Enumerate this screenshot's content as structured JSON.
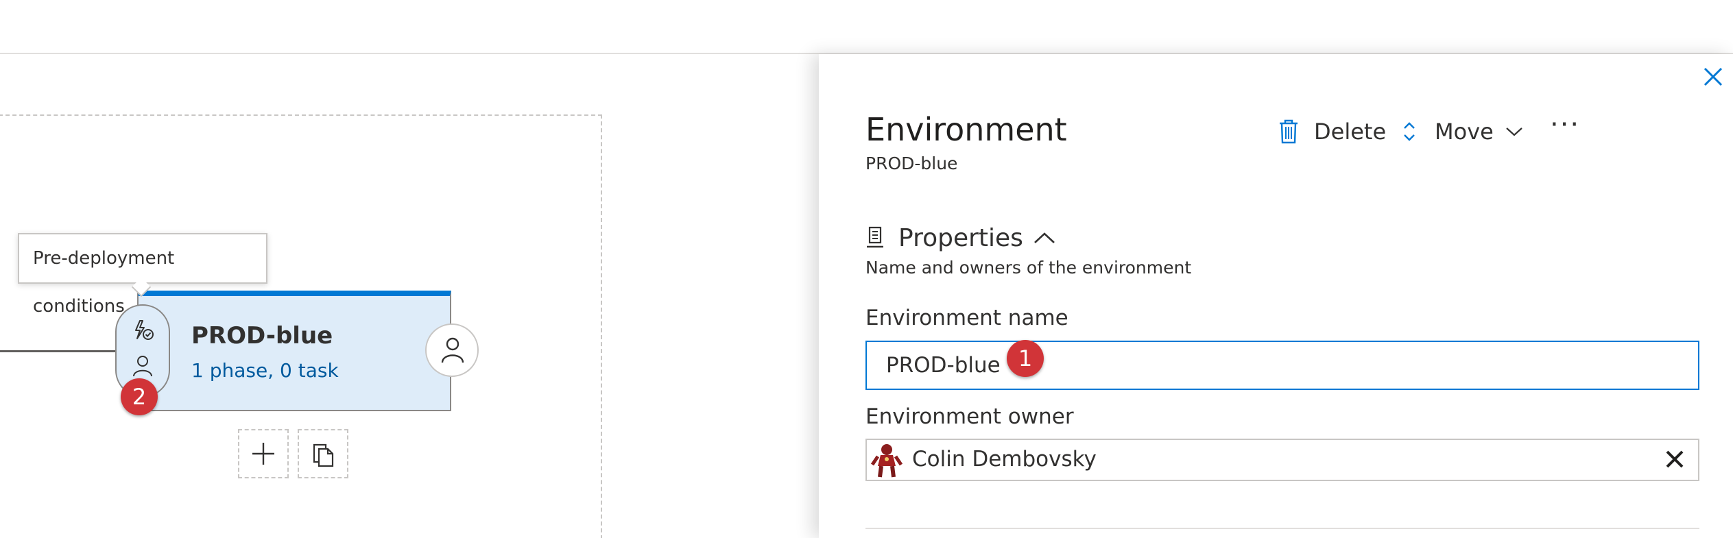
{
  "pipeline": {
    "tooltip": "Pre-deployment conditions",
    "environment": {
      "name": "PROD-blue",
      "summary": "1 phase, 0 task"
    },
    "badge_pre": "2"
  },
  "panel": {
    "title": "Environment",
    "subtitle": "PROD-blue",
    "toolbar": {
      "delete_label": "Delete",
      "move_label": "Move",
      "more_label": "···"
    },
    "properties": {
      "heading": "Properties",
      "description": "Name and owners of the environment"
    },
    "fields": {
      "name_label": "Environment name",
      "name_value": "PROD-blue",
      "name_badge": "1",
      "owner_label": "Environment owner",
      "owner_value": "Colin Dembovsky"
    }
  },
  "colors": {
    "accent": "#0078d4",
    "badge": "#d13438",
    "card_fill": "#deecf9"
  },
  "icons": {
    "close": "close-icon",
    "delete": "trash-icon",
    "move": "up-down-arrow-icon",
    "chevron": "chevron-down-icon",
    "properties": "properties-icon",
    "collapse": "chevron-up-icon",
    "pre_conditions": "lightning-check-icon",
    "approver": "person-icon",
    "add": "plus-icon",
    "clone": "clone-icon",
    "clear": "clear-x-icon"
  }
}
